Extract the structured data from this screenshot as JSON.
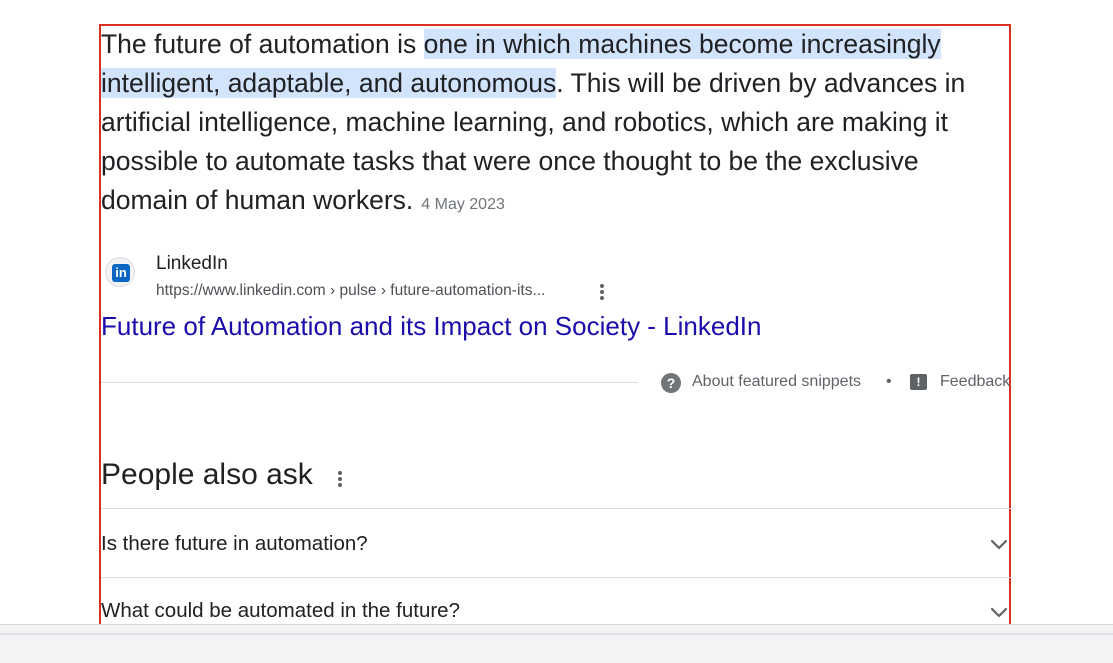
{
  "snippet": {
    "text_before": "The future of automation is ",
    "highlighted": "one in which machines become increasingly intelligent, adaptable, and autonomous",
    "text_after": ". This will be driven by advances in artificial intelligence, machine learning, and robotics, which are making it possible to automate tasks that were once thought to be the exclusive domain of human workers.",
    "date": "4 May 2023"
  },
  "source": {
    "favicon_icon": "linkedin-logo-icon",
    "favicon_text": "in",
    "site_name": "LinkedIn",
    "url": "https://www.linkedin.com › pulse › future-automation-its...",
    "menu_icon": "more-vert-icon"
  },
  "result": {
    "title": "Future of Automation and its Impact on Society - LinkedIn"
  },
  "footer_links": {
    "help_icon": "help-circle-icon",
    "help_glyph": "?",
    "about_label": "About featured snippets",
    "separator": "•",
    "feedback_icon": "feedback-icon",
    "feedback_glyph": "!",
    "feedback_label": "Feedback"
  },
  "people_also_ask": {
    "title": "People also ask",
    "menu_icon": "more-vert-icon",
    "questions": [
      {
        "text": "Is there future in automation?",
        "icon": "chevron-down-icon"
      },
      {
        "text": "What could be automated in the future?",
        "icon": "chevron-down-icon"
      }
    ]
  },
  "colors": {
    "highlight": "#d2e3fc",
    "link": "#1a0dab",
    "frame_border": "#d93025",
    "text": "#202124",
    "muted": "#70757a"
  }
}
